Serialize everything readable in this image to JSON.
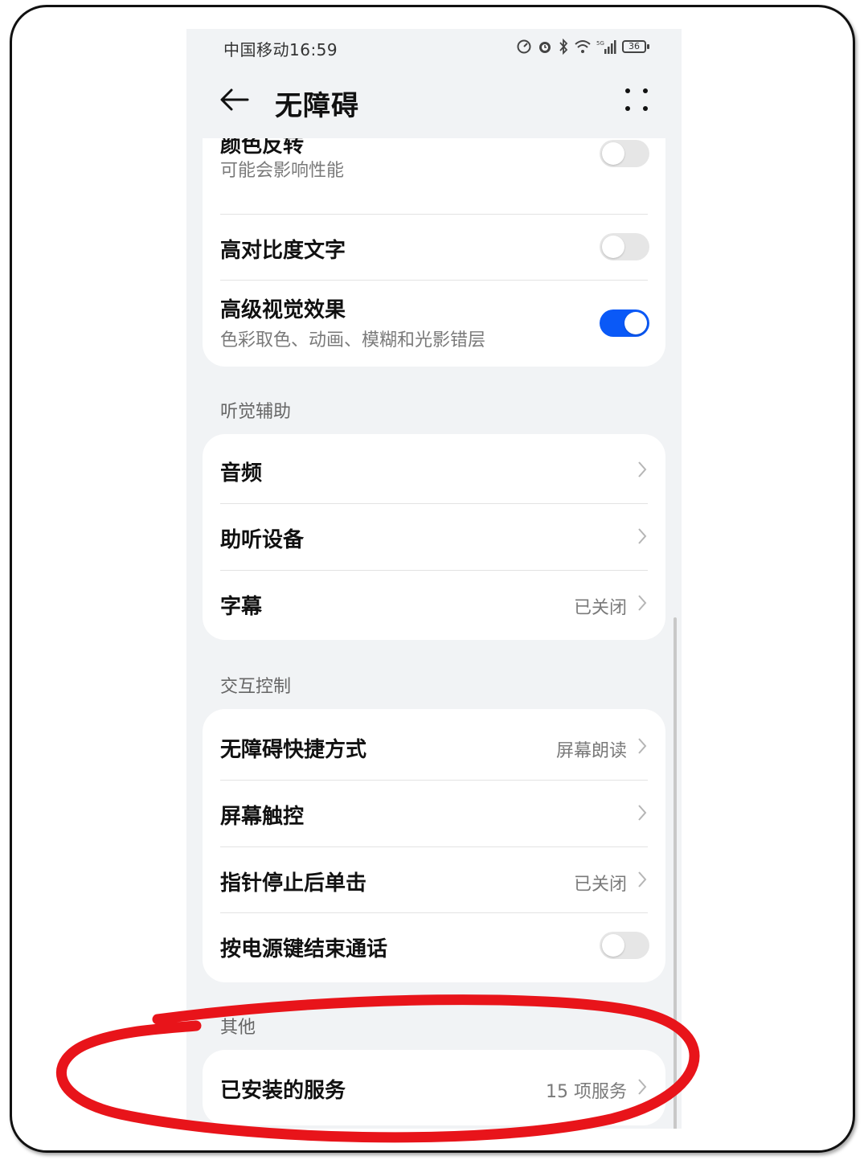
{
  "status_bar": {
    "carrier_time": "中国移动16:59",
    "battery": "36",
    "network": "5G"
  },
  "header": {
    "title": "无障碍",
    "back_icon": "arrow-left-icon",
    "more_icon": "more-dots-icon"
  },
  "display_section": {
    "items": [
      {
        "title": "颜色反转",
        "subtitle": "可能会影响性能",
        "toggle": false
      },
      {
        "title": "高对比度文字",
        "toggle": false
      },
      {
        "title": "高级视觉效果",
        "subtitle": "色彩取色、动画、模糊和光影错层",
        "toggle": true
      }
    ]
  },
  "hearing_section": {
    "label": "听觉辅助",
    "items": [
      {
        "title": "音频"
      },
      {
        "title": "助听设备"
      },
      {
        "title": "字幕",
        "value": "已关闭"
      }
    ]
  },
  "interaction_section": {
    "label": "交互控制",
    "items": [
      {
        "title": "无障碍快捷方式",
        "value": "屏幕朗读"
      },
      {
        "title": "屏幕触控"
      },
      {
        "title": "指针停止后单击",
        "value": "已关闭"
      },
      {
        "title": "按电源键结束通话",
        "toggle": false
      }
    ]
  },
  "other_section": {
    "label": "其他",
    "items": [
      {
        "title": "已安装的服务",
        "value": "15 项服务"
      }
    ]
  },
  "colors": {
    "accent": "#0a59f7",
    "page_bg": "#f1f3f5",
    "card_bg": "#ffffff",
    "annotation": "#e8141a"
  }
}
